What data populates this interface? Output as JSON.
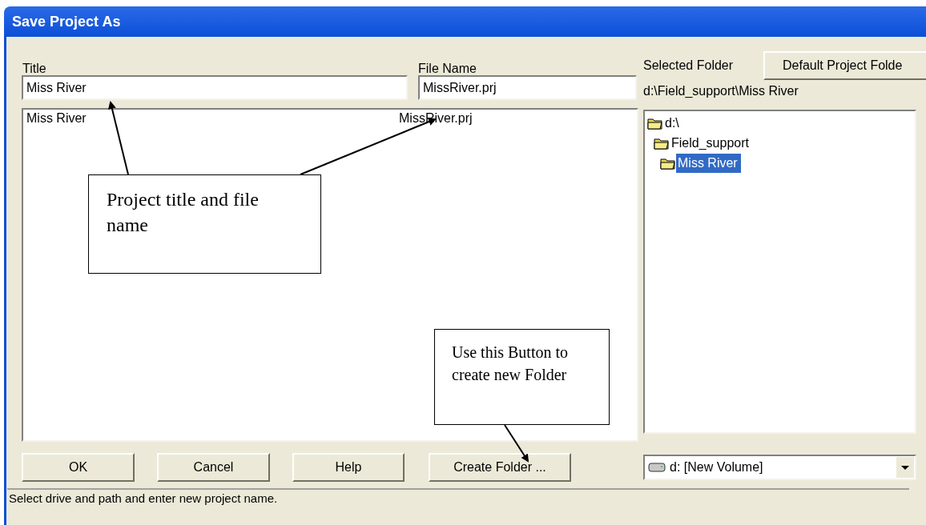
{
  "window": {
    "title": "Save Project As"
  },
  "title_field": {
    "label": "Title",
    "value": "Miss River"
  },
  "file_name_field": {
    "label": "File Name",
    "value": "MissRiver.prj"
  },
  "selected_folder": {
    "label": "Selected Folder",
    "path": "d:\\Field_support\\Miss River"
  },
  "default_folder_button": "Default Project Folde",
  "project_list": [
    {
      "title": "Miss River",
      "file_name": "MissRiver.prj",
      "selected": false
    }
  ],
  "folder_tree": [
    {
      "label": "d:\\",
      "selected": false,
      "children": [
        {
          "label": "Field_support",
          "selected": false,
          "children": [
            {
              "label": "Miss River",
              "selected": true
            }
          ]
        }
      ]
    }
  ],
  "buttons": [
    "OK",
    "Cancel",
    "Help",
    "Create Folder ..."
  ],
  "drive_combo": {
    "value": "d: [New Volume]"
  },
  "status_bar": "Select drive and path and enter new project name.",
  "callouts": [
    {
      "text": "Project title and file name"
    },
    {
      "text": "Use this Button to create new Folder"
    }
  ]
}
